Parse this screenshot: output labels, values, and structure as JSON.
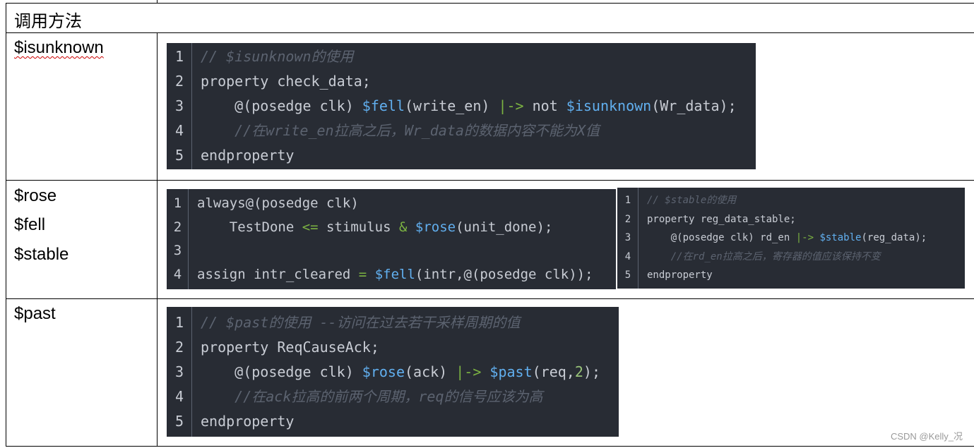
{
  "header": "调用方法",
  "rows": [
    {
      "label": "$isunknown"
    },
    {
      "labels": [
        "$rose",
        "$fell",
        "$stable"
      ]
    },
    {
      "label": "$past"
    }
  ],
  "code_blocks": [
    {
      "name": "isunknown-code",
      "lines": [
        [
          [
            "c",
            "// $isunknown的使用"
          ]
        ],
        [
          [
            "p",
            "property check_data;"
          ]
        ],
        [
          [
            "p",
            "    @(posedge clk) "
          ],
          [
            "f",
            "$fell"
          ],
          [
            "p",
            "(write_en) "
          ],
          [
            "o",
            "|->"
          ],
          [
            "p",
            " not "
          ],
          [
            "f",
            "$isunknown"
          ],
          [
            "p",
            "(Wr_data);"
          ]
        ],
        [
          [
            "c",
            "    //在write_en拉高之后，Wr_data的数据内容不能为X值"
          ]
        ],
        [
          [
            "p",
            "endproperty"
          ]
        ]
      ]
    },
    {
      "name": "rose-fell-code",
      "lines": [
        [
          [
            "p",
            "always@(posedge clk)"
          ]
        ],
        [
          [
            "p",
            "    TestDone "
          ],
          [
            "o",
            "<="
          ],
          [
            "p",
            " stimulus "
          ],
          [
            "o",
            "&"
          ],
          [
            "p",
            " "
          ],
          [
            "f",
            "$rose"
          ],
          [
            "p",
            "(unit_done);"
          ]
        ],
        [
          [
            "p",
            ""
          ]
        ],
        [
          [
            "p",
            "assign intr_cleared "
          ],
          [
            "o",
            "="
          ],
          [
            "p",
            " "
          ],
          [
            "f",
            "$fell"
          ],
          [
            "p",
            "(intr,@(posedge clk));"
          ]
        ]
      ]
    },
    {
      "name": "stable-code",
      "lines": [
        [
          [
            "c",
            "// $stable的使用"
          ]
        ],
        [
          [
            "p",
            "property reg_data_stable;"
          ]
        ],
        [
          [
            "p",
            "    @(posedge clk) rd_en "
          ],
          [
            "o",
            "|->"
          ],
          [
            "p",
            " "
          ],
          [
            "f",
            "$stable"
          ],
          [
            "p",
            "(reg_data);"
          ]
        ],
        [
          [
            "c",
            "    //在rd_en拉高之后，寄存器的值应该保持不变"
          ]
        ],
        [
          [
            "p",
            "endproperty"
          ]
        ]
      ]
    },
    {
      "name": "past-code",
      "lines": [
        [
          [
            "c",
            "// $past的使用 --访问在过去若干采样周期的值"
          ]
        ],
        [
          [
            "p",
            "property ReqCauseAck;"
          ]
        ],
        [
          [
            "p",
            "    @(posedge clk) "
          ],
          [
            "f",
            "$rose"
          ],
          [
            "p",
            "(ack) "
          ],
          [
            "o",
            "|->"
          ],
          [
            "p",
            " "
          ],
          [
            "f",
            "$past"
          ],
          [
            "p",
            "(req,"
          ],
          [
            "n",
            "2"
          ],
          [
            "p",
            ");"
          ]
        ],
        [
          [
            "c",
            "    //在ack拉高的前两个周期，req的信号应该为高"
          ]
        ],
        [
          [
            "p",
            "endproperty"
          ]
        ]
      ]
    }
  ],
  "watermark": "CSDN @Kelly_况",
  "colors": {
    "code_bg": "#282c34",
    "comment": "#5c6370",
    "function": "#61afef",
    "operator": "#7cb342"
  }
}
